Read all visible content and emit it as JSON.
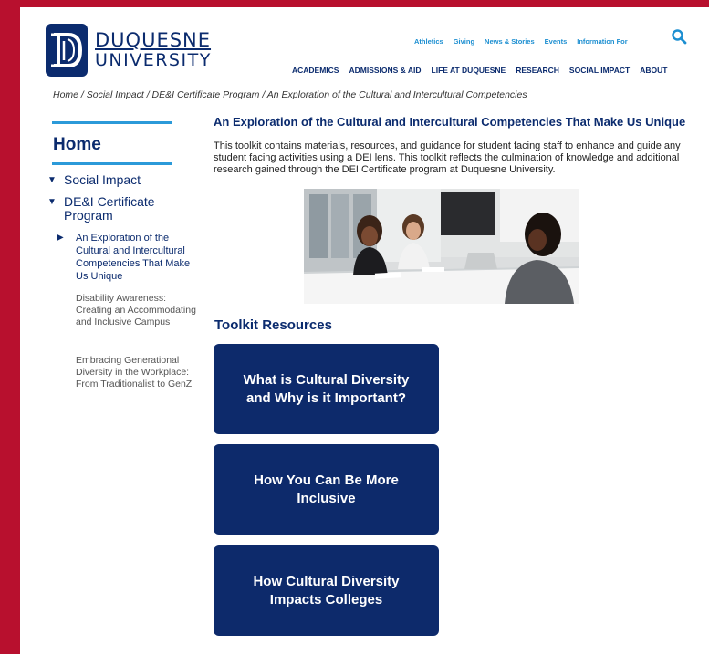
{
  "logo": {
    "line1": "DUQUESNE",
    "line2": "UNIVERSITY"
  },
  "utility_nav": [
    "Athletics",
    "Giving",
    "News & Stories",
    "Events",
    "Information For"
  ],
  "main_nav": [
    "ACADEMICS",
    "ADMISSIONS & AID",
    "LIFE AT DUQUESNE",
    "RESEARCH",
    "SOCIAL IMPACT",
    "ABOUT"
  ],
  "breadcrumb": "Home / Social Impact / DE&I Certificate Program / An Exploration of the Cultural and Intercultural Competencies",
  "sidebar": {
    "home": "Home",
    "items": [
      {
        "label": "Social Impact",
        "marker": "▼"
      },
      {
        "label": "DE&I Certificate Program",
        "marker": "▼"
      }
    ],
    "current": {
      "label": "An Exploration of the Cultural and Intercultural Competencies That Make Us Unique",
      "marker": "▶"
    },
    "links": [
      "Disability Awareness: Creating an Accommodating and Inclusive Campus",
      "Embracing Generational Diversity in the Workplace: From Traditionalist to GenZ"
    ]
  },
  "content": {
    "title": "An Exploration of the Cultural and Intercultural Competencies That Make Us Unique",
    "intro": "This toolkit contains materials, resources, and guidance for student facing staff to enhance and guide any student facing activities using a DEI lens. This toolkit reflects the culmination of knowledge and additional research gained through the DEI Certificate program at Duquesne University."
  },
  "toolkit": {
    "heading": "Toolkit Resources",
    "cards": [
      "What is Cultural Diversity and Why is it Important?",
      "How You Can Be More Inclusive",
      "How Cultural Diversity Impacts Colleges"
    ]
  },
  "colors": {
    "frame": "#b8102e",
    "navy": "#0b2b6e",
    "accent_blue": "#1d8fd1",
    "rule_blue": "#2b9ad9"
  },
  "icons": [
    "duquesne-logo-icon",
    "search-icon"
  ]
}
